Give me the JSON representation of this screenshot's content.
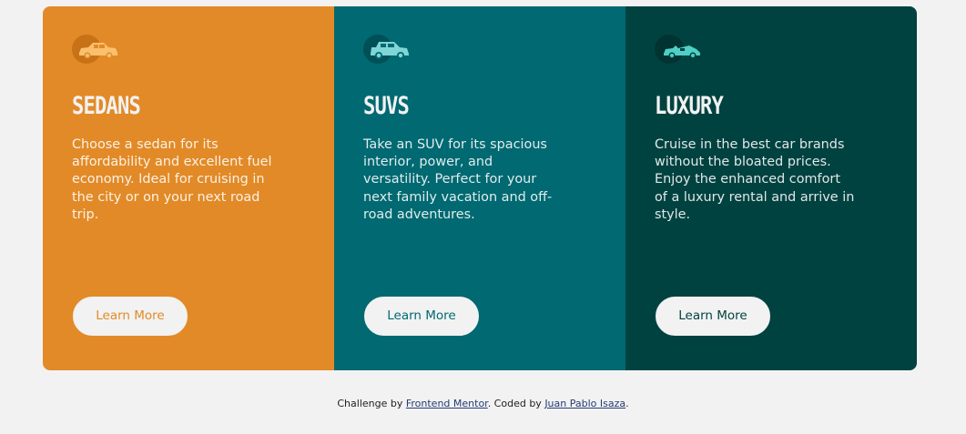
{
  "colors": {
    "sedans": "#e28a27",
    "suvs": "#006971",
    "luxury": "#004240",
    "background": "#f2f2f2"
  },
  "cards": [
    {
      "icon": "sedan-car-icon",
      "title": "SEDANS",
      "description": "Choose a sedan for its affordability and excellent fuel economy. Ideal for cruising in the city or on your next road trip.",
      "button_label": "Learn More"
    },
    {
      "icon": "suv-car-icon",
      "title": "SUVS",
      "description": "Take an SUV for its spacious interior, power, and versatility. Perfect for your next family vacation and off-road adventures.",
      "button_label": "Learn More"
    },
    {
      "icon": "luxury-car-icon",
      "title": "LUXURY",
      "description": "Cruise in the best car brands without the bloated prices. Enjoy the enhanced comfort of a luxury rental and arrive in style.",
      "button_label": "Learn More"
    }
  ],
  "footer": {
    "prefix": "Challenge by ",
    "link1": "Frontend Mentor",
    "middle": ". Coded by ",
    "link2": "Juan Pablo Isaza",
    "suffix": "."
  }
}
